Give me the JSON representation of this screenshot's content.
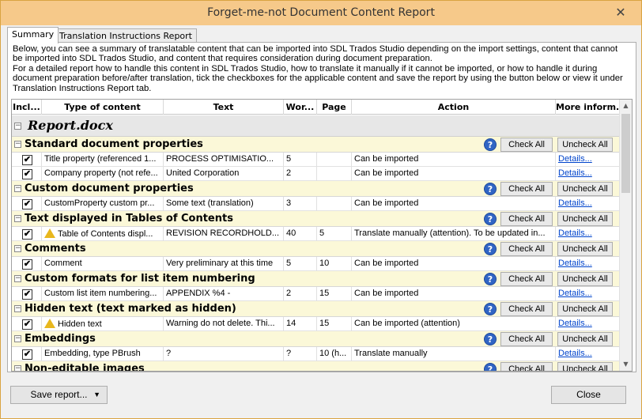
{
  "window": {
    "title": "Forget-me-not Document Content Report"
  },
  "tabs": [
    {
      "label": "Summary"
    },
    {
      "label": "Translation Instructions Report"
    }
  ],
  "description": {
    "line1": "Below, you can see a summary of translatable content that can be imported into SDL Trados Studio depending on the import settings, content that cannot",
    "line2": "be imported into SDL Trados Studio, and content that requires consideration during document preparation.",
    "line3": "For a detailed report how to handle this content in SDL Trados Studio, how to translate it manually if it cannot be imported, or how to handle it during",
    "line4": "document preparation before/after translation, tick the checkboxes for the applicable content and save the report by using the button below or view it under",
    "line5": "Translation Instructions Report tab."
  },
  "columns": [
    "Incl...",
    "Type of content",
    "Text",
    "Wor...",
    "Page",
    "Action",
    "More inform..."
  ],
  "file": {
    "name": "Report.docx"
  },
  "buttons": {
    "check_all": "Check All",
    "uncheck_all": "Uncheck All",
    "save_report": "Save report...",
    "close": "Close"
  },
  "categories": [
    {
      "title": "Standard document properties",
      "items": [
        {
          "type": "Title property (referenced 1...",
          "text": "PROCESS  OPTIMISATIO...",
          "words": "5",
          "page": "",
          "action": "Can be imported",
          "more": "Details...",
          "warn": false
        },
        {
          "type": "Company property (not refe...",
          "text": "United Corporation",
          "words": "2",
          "page": "",
          "action": "Can be imported",
          "more": "Details...",
          "warn": false
        }
      ]
    },
    {
      "title": "Custom document properties",
      "items": [
        {
          "type": "CustomProperty custom pr...",
          "text": "Some text (translation)",
          "words": "3",
          "page": "",
          "action": "Can be imported",
          "more": "Details...",
          "warn": false
        }
      ]
    },
    {
      "title": "Text displayed in Tables of Contents",
      "items": [
        {
          "type": "Table of Contents displ...",
          "text": "REVISION  RECORDHOLD...",
          "words": "40",
          "page": "5",
          "action": "Translate manually (attention). To be updated in...",
          "more": "Details...",
          "warn": true
        }
      ]
    },
    {
      "title": "Comments",
      "items": [
        {
          "type": "Comment",
          "text": "Very preliminary at this time",
          "words": "5",
          "page": "10",
          "action": "Can be imported",
          "more": "Details...",
          "warn": false
        }
      ]
    },
    {
      "title": "Custom formats for list item numbering",
      "items": [
        {
          "type": "Custom list item numbering...",
          "text": "APPENDIX %4 -",
          "words": "2",
          "page": "15",
          "action": "Can be imported",
          "more": "Details...",
          "warn": false
        }
      ]
    },
    {
      "title": "Hidden text (text marked as hidden)",
      "items": [
        {
          "type": "Hidden text",
          "text": "Warning do not delete. Thi...",
          "words": "14",
          "page": "15",
          "action": "Can be imported (attention)",
          "more": "Details...",
          "warn": true
        }
      ]
    },
    {
      "title": "Embeddings",
      "items": [
        {
          "type": "Embedding, type PBrush",
          "text": "?",
          "words": "?",
          "page": "10 (h...",
          "action": "Translate manually",
          "more": "Details...",
          "warn": false
        }
      ]
    },
    {
      "title": "Non-editable images",
      "items": []
    }
  ]
}
